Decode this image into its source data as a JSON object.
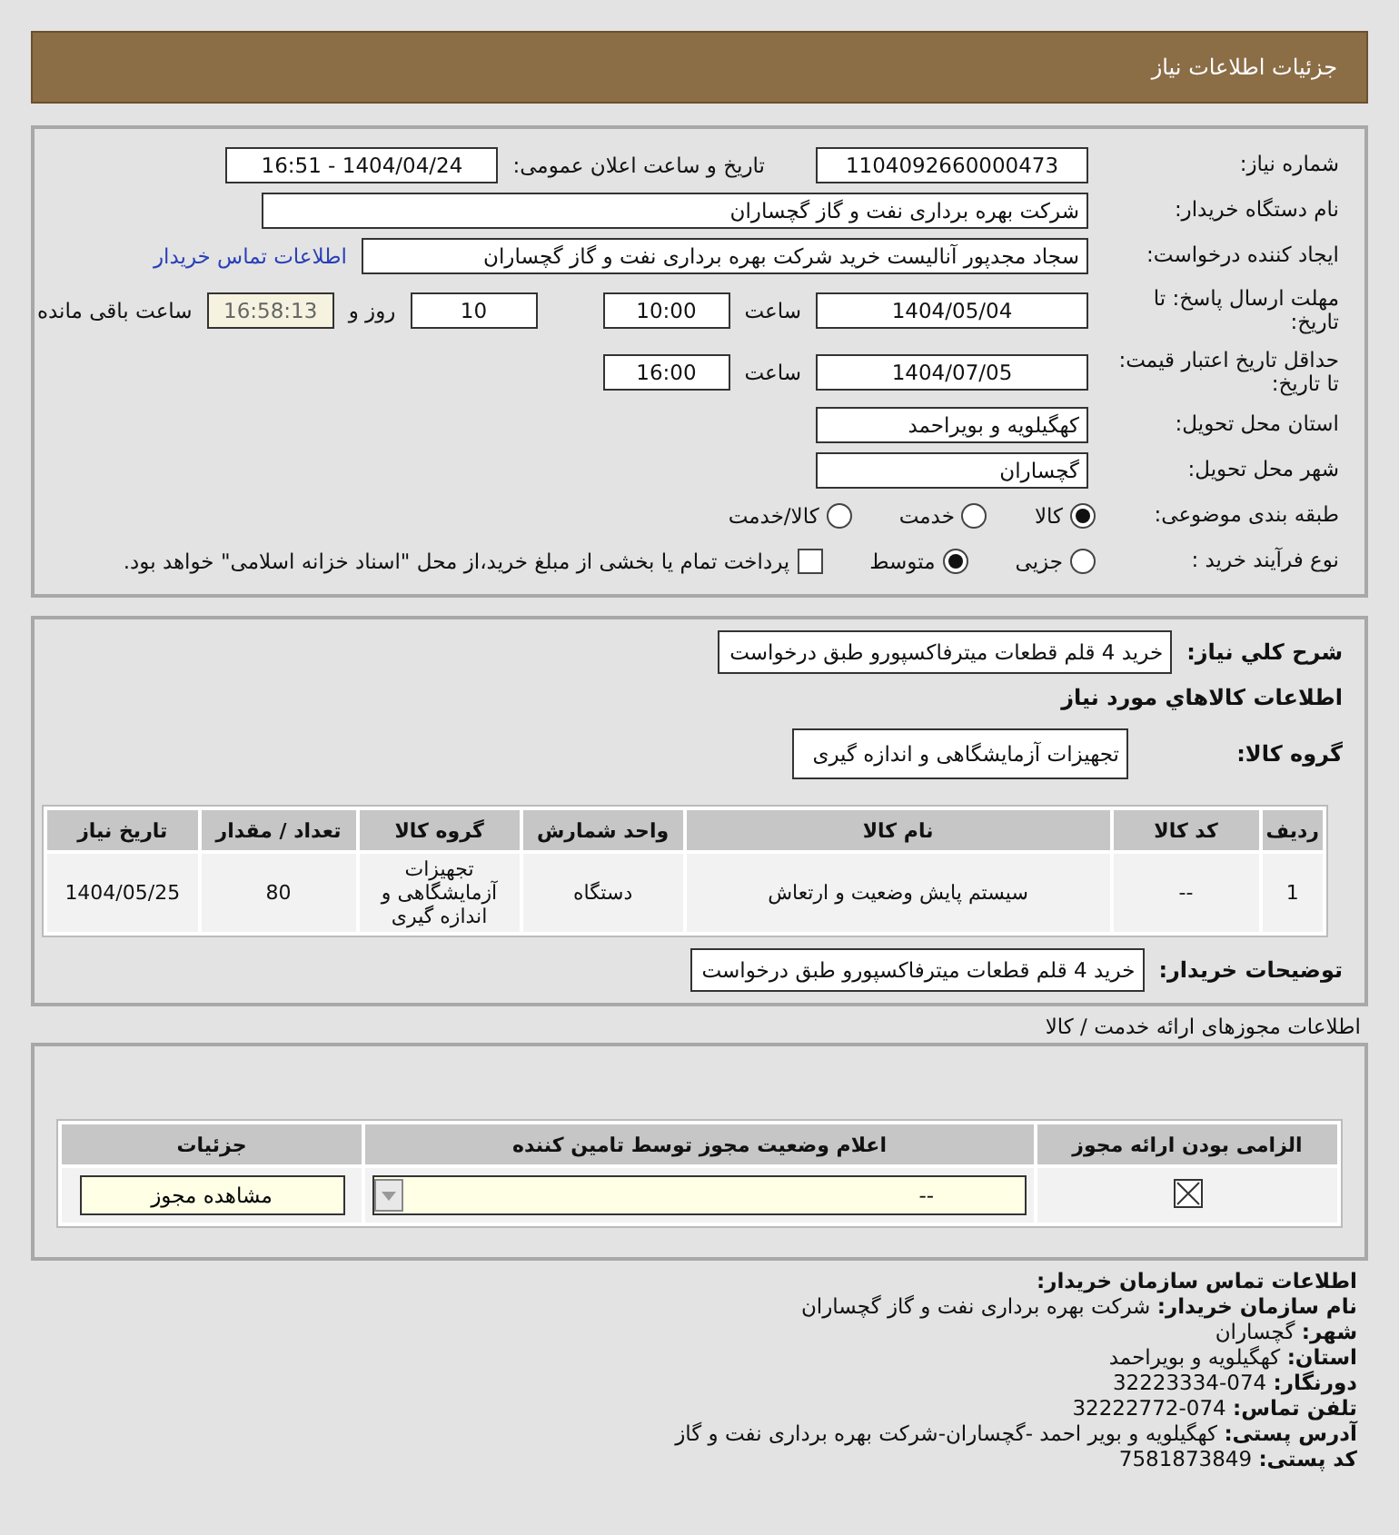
{
  "header": {
    "title": "جزئیات اطلاعات نیاز"
  },
  "details": {
    "need_number": {
      "label": "شماره نیاز:",
      "value": "1104092660000473"
    },
    "announce": {
      "label": "تاریخ و ساعت اعلان عمومی:",
      "value": "1404/04/24 - 16:51"
    },
    "buyer": {
      "label": "نام دستگاه خریدار:",
      "value": "شرکت بهره برداری نفت و گاز گچساران"
    },
    "creator": {
      "label": "ایجاد کننده درخواست:",
      "value": "سجاد مجدپور آنالیست خرید شرکت بهره برداری نفت و گاز گچساران",
      "link": "اطلاعات تماس خریدار"
    },
    "deadline": {
      "label": "مهلت ارسال پاسخ: تا تاریخ:",
      "date": "1404/05/04",
      "time_label": "ساعت",
      "time": "10:00",
      "days": "10",
      "days_label": "روز و",
      "remaining": "16:58:13",
      "remaining_label": "ساعت باقی مانده"
    },
    "validity": {
      "label": "حداقل تاریخ اعتبار قیمت: تا تاریخ:",
      "date": "1404/07/05",
      "time_label": "ساعت",
      "time": "16:00"
    },
    "province": {
      "label": "استان محل تحویل:",
      "value": "کهگیلویه و بویراحمد"
    },
    "city": {
      "label": "شهر محل تحویل:",
      "value": "گچساران"
    },
    "category": {
      "label": "طبقه بندی موضوعی:",
      "options": [
        {
          "label": "کالا",
          "selected": true
        },
        {
          "label": "خدمت",
          "selected": false
        },
        {
          "label": "کالا/خدمت",
          "selected": false
        }
      ]
    },
    "process": {
      "label": "نوع فرآیند خرید :",
      "options": [
        {
          "label": "جزیی",
          "selected": false
        },
        {
          "label": "متوسط",
          "selected": true
        }
      ],
      "payment": {
        "checked": false,
        "label": "پرداخت تمام یا بخشی از مبلغ خرید،از محل \"اسناد خزانه اسلامی\" خواهد بود."
      }
    }
  },
  "summary": {
    "label": "شرح كلي نياز:",
    "value": "خرید 4 قلم قطعات میترفاکسپورو طبق درخواست"
  },
  "goods_title": "اطلاعات كالاهاي مورد نياز",
  "group": {
    "label": "گروه کالا:",
    "value": "تجهیزات آزمایشگاهی و اندازه گیری"
  },
  "goods_table": {
    "columns": [
      "ردیف",
      "کد کالا",
      "نام کالا",
      "واحد شمارش",
      "گروه کالا",
      "تعداد / مقدار",
      "تاریخ نیاز"
    ],
    "rows": [
      [
        "1",
        "--",
        "سیستم پایش وضعیت و ارتعاش",
        "دستگاه",
        "تجهیزات آزمایشگاهی و اندازه گیری",
        "80",
        "1404/05/25"
      ]
    ]
  },
  "notes": {
    "label": "توضیحات خریدار:",
    "value": "خرید 4 قلم قطعات میترفاکسپورو طبق درخواست"
  },
  "permits_title": "اطلاعات مجوزهای ارائه خدمت / کالا",
  "permits_table": {
    "columns": [
      "الزامی بودن ارائه مجوز",
      "اعلام وضعیت مجوز توسط تامین کننده",
      "جزئیات"
    ],
    "rows": [
      {
        "required": true,
        "status": "--",
        "button": "مشاهده مجوز"
      }
    ]
  },
  "contact": {
    "title": "اطلاعات تماس سازمان خریدار:",
    "lines": [
      {
        "label": "نام سازمان خریدار:",
        "value": "شرکت بهره برداری نفت و گاز گچساران"
      },
      {
        "label": "شهر:",
        "value": "گچساران"
      },
      {
        "label": "استان:",
        "value": "کهگیلویه و بویراحمد"
      },
      {
        "label": "دورنگار:",
        "value": "074-32223334"
      },
      {
        "label": "تلفن تماس:",
        "value": "074-32222772"
      },
      {
        "label": "آدرس پستی:",
        "value": "کهگیلویه و بویر احمد -گچساران-شرکت بهره برداری نفت و گاز"
      },
      {
        "label": "کد پستی:",
        "value": "7581873849"
      }
    ]
  }
}
